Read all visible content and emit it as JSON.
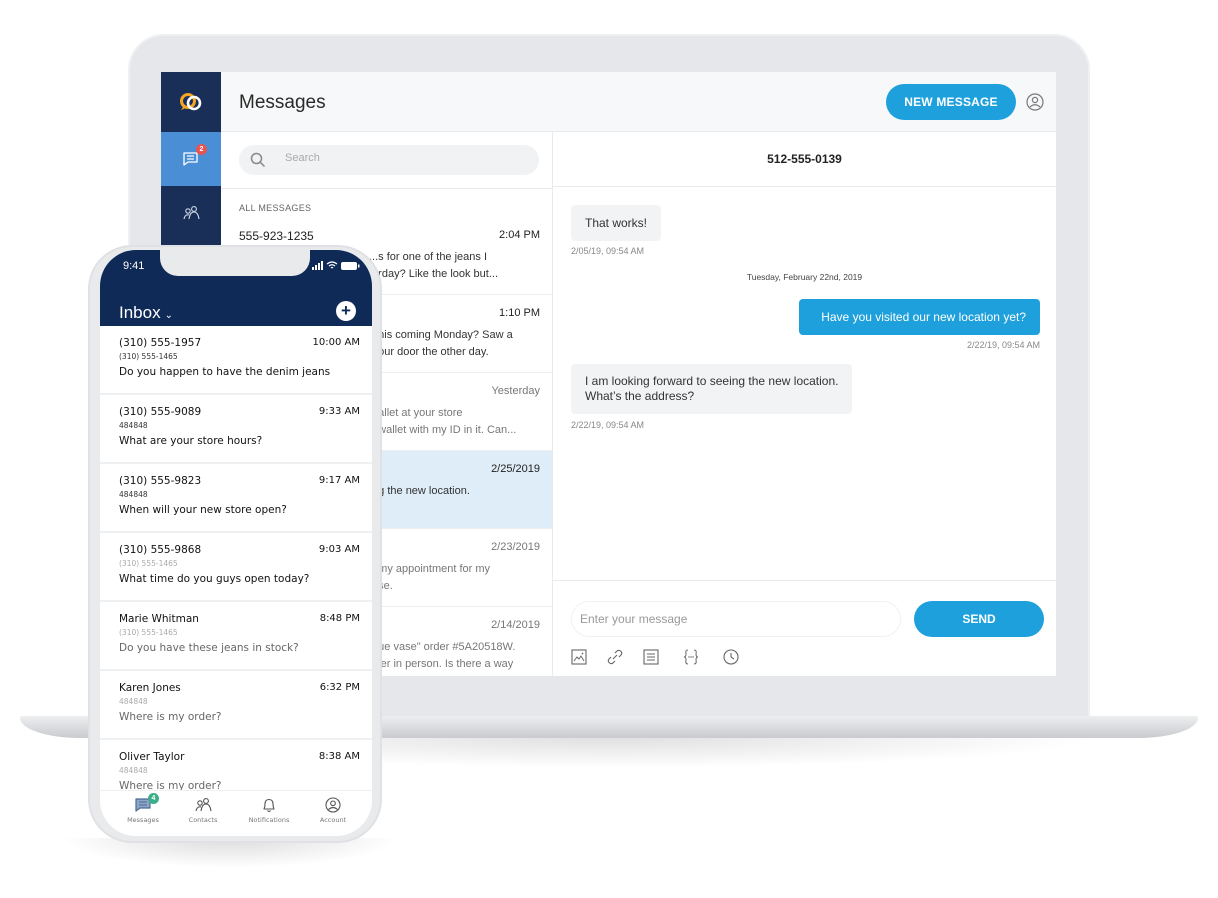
{
  "desktop": {
    "header": {
      "title": "Messages",
      "new_message_label": "NEW MESSAGE"
    },
    "sidebar": {
      "messages_badge": "2"
    },
    "search": {
      "placeholder": "Search"
    },
    "list": {
      "section_label": "ALL MESSAGES",
      "items": [
        {
          "name": "555-923-1235",
          "time": "2:04 PM",
          "preview_line1": "...s for one of the jeans I",
          "preview_line2": "...rday? Like the look but..."
        },
        {
          "name": "",
          "time": "1:10 PM",
          "preview_line1": "...his coming Monday? Saw a",
          "preview_line2": "...our door the other day."
        },
        {
          "name": "",
          "time": "Yesterday",
          "preview_line1": "...allet at your store",
          "preview_line2": "...wallet with my ID in it. Can..."
        },
        {
          "name": "",
          "time": "2/25/2019",
          "preview_line1": "...g the new location.",
          "preview_line2": ""
        },
        {
          "name": "",
          "time": "2/23/2019",
          "preview_line1": "...my appointment for my",
          "preview_line2": "...se."
        },
        {
          "name": "",
          "time": "2/14/2019",
          "preview_line1": "...ue vase\" order #5A20518W.",
          "preview_line2": "...ler in person. Is there a way"
        }
      ]
    },
    "chat": {
      "contact": "512-555-0139",
      "messages": [
        {
          "direction": "in",
          "text": "That works!",
          "time": "2/05/19, 09:54 AM"
        },
        {
          "direction": "out",
          "text": "Have you visited our new location yet?",
          "time": "2/22/19, 09:54 AM"
        },
        {
          "direction": "in",
          "text_line1": "I am looking forward to seeing the new location.",
          "text_line2": "What’s the address?",
          "time": "2/22/19, 09:54 AM"
        }
      ],
      "date_separator": "Tuesday, February 22nd, 2019",
      "composer_placeholder": "Enter your message",
      "send_label": "SEND"
    },
    "colors": {
      "accent": "#1ea0dc",
      "sidebar": "#1a2f57",
      "sidebar_active": "#4a8fd6",
      "badge": "#e55353"
    }
  },
  "phone": {
    "status_time": "9:41",
    "inbox_title": "Inbox",
    "items": [
      {
        "name": "(310) 555-1957",
        "time": "10:00 AM",
        "sub": "(310) 555-1465",
        "preview": "Do you happen to have the denim jeans"
      },
      {
        "name": "(310) 555-9089",
        "time": "9:33 AM",
        "sub": "484848",
        "preview": "What are your store hours?"
      },
      {
        "name": "(310) 555-9823",
        "time": "9:17 AM",
        "sub": "484848",
        "preview": "When will your new store open?"
      },
      {
        "name": "(310) 555-9868",
        "time": "9:03 AM",
        "sub": "(310) 555-1465",
        "preview": "What time do you guys open today?"
      },
      {
        "name": "Marie Whitman",
        "time": "8:48 PM",
        "sub": "(310) 555-1465",
        "preview": "Do you have these jeans in stock?"
      },
      {
        "name": "Karen Jones",
        "time": "6:32 PM",
        "sub": "484848",
        "preview": "Where is my order?"
      },
      {
        "name": "Oliver Taylor",
        "time": "8:38 AM",
        "sub": "484848",
        "preview": "Where is my order?"
      }
    ],
    "tabs": {
      "messages": "Messages",
      "contacts": "Contacts",
      "notifications": "Notifications",
      "account": "Account",
      "messages_badge": "4"
    },
    "colors": {
      "header": "#0f2a56",
      "badge": "#3cae8a"
    }
  }
}
